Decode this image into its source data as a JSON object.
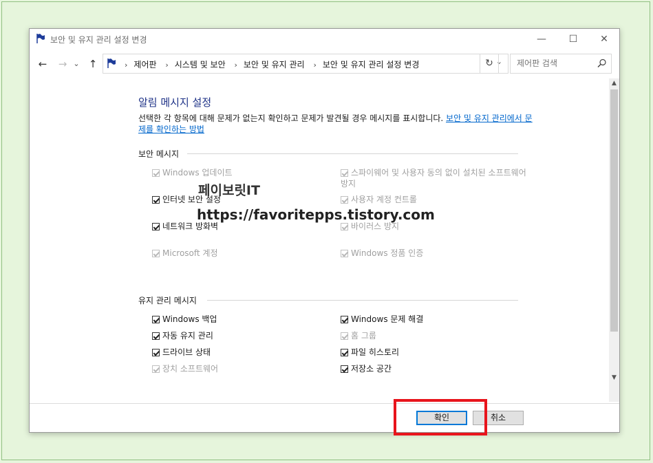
{
  "window": {
    "title": "보안 및 유지 관리 설정 변경",
    "minimize": "—",
    "maximize": "☐",
    "close": "✕"
  },
  "nav": {
    "back": "←",
    "forward": "→",
    "recent": "⌄",
    "up": "↑"
  },
  "address": {
    "crumbs": [
      "제어판",
      "시스템 및 보안",
      "보안 및 유지 관리",
      "보안 및 유지 관리 설정 변경"
    ],
    "separator": "›",
    "dropdown": "⌄",
    "refresh": "↻"
  },
  "search": {
    "placeholder": "제어판 검색"
  },
  "content": {
    "heading": "알림 메시지 설정",
    "description": "선택한 각 항목에 대해 문제가 없는지 확인하고 문제가 발견될 경우 메시지를 표시합니다. ",
    "description_link": "보안 및 유지 관리에서 문제를 확인하는 방법",
    "security_section": "보안 메시지",
    "security_items": [
      {
        "label": "Windows 업데이트",
        "checked": true,
        "enabled": false
      },
      {
        "label": "스파이웨어 및 사용자 동의 없이 설치된 소프트웨어 방지",
        "checked": true,
        "enabled": false
      },
      {
        "label": "인터넷 보안 설정",
        "checked": true,
        "enabled": true
      },
      {
        "label": "사용자 계정 컨트롤",
        "checked": true,
        "enabled": false
      },
      {
        "label": "네트워크 방화벽",
        "checked": true,
        "enabled": true
      },
      {
        "label": "바이러스 방지",
        "checked": true,
        "enabled": false
      },
      {
        "label": "Microsoft 계정",
        "checked": true,
        "enabled": false
      },
      {
        "label": "Windows 정품 인증",
        "checked": true,
        "enabled": false
      }
    ],
    "maintenance_section": "유지 관리 메시지",
    "maintenance_items": [
      {
        "label": "Windows 백업",
        "checked": true,
        "enabled": true
      },
      {
        "label": "Windows 문제 해결",
        "checked": true,
        "enabled": true
      },
      {
        "label": "자동 유지 관리",
        "checked": true,
        "enabled": true
      },
      {
        "label": "홈 그룹",
        "checked": true,
        "enabled": false
      },
      {
        "label": "드라이브 상태",
        "checked": true,
        "enabled": true
      },
      {
        "label": "파일 히스토리",
        "checked": true,
        "enabled": true
      },
      {
        "label": "장치 소프트웨어",
        "checked": true,
        "enabled": false
      },
      {
        "label": "저장소 공간",
        "checked": true,
        "enabled": true
      }
    ]
  },
  "buttons": {
    "ok": "확인",
    "cancel": "취소"
  },
  "watermark": {
    "name": "페이보릿IT",
    "url": "https://favoritepps.tistory.com"
  },
  "colors": {
    "accent": "#0078d7",
    "link": "#0066cc",
    "heading": "#1e3287",
    "highlight": "#e8141c",
    "flag": "#1e3c9a"
  }
}
